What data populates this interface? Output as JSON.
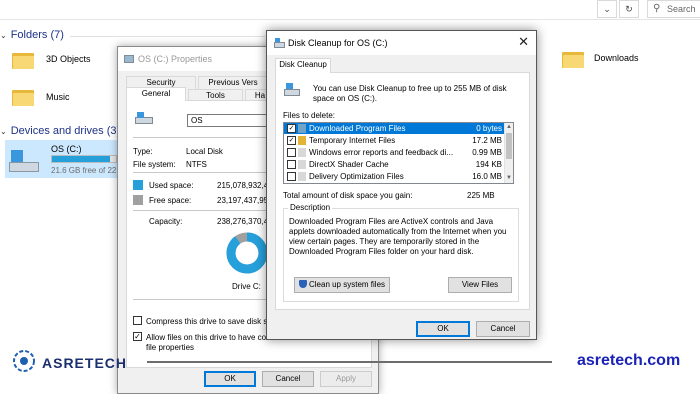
{
  "explorer": {
    "search_placeholder": "Search",
    "folders_header": "Folders (7)",
    "devices_header": "Devices and drives (3)",
    "folders": [
      {
        "name": "3D Objects"
      },
      {
        "name": "Music"
      },
      {
        "name": "Downloads"
      }
    ],
    "drive": {
      "name": "OS  (C:)",
      "free_text": "21.6 GB free of 221",
      "used_fraction": 0.9
    }
  },
  "properties": {
    "title": "OS  (C:) Properties",
    "tabs": [
      "Security",
      "Previous Vers",
      "General",
      "Tools",
      "Ha"
    ],
    "drive_label_value": "OS",
    "type_label": "Type:",
    "type_value": "Local Disk",
    "fs_label": "File system:",
    "fs_value": "NTFS",
    "used_label": "Used space:",
    "used_value": "215,078,932,48",
    "free_label": "Free space:",
    "free_value": "23,197,437,95",
    "capacity_label": "Capacity:",
    "capacity_value": "238,276,370,43",
    "drive_caption": "Drive C:",
    "compress_label": "Compress this drive to save disk spa",
    "index_label_1": "Allow files on this drive to have conte",
    "index_label_2": "file properties",
    "ok": "OK",
    "cancel": "Cancel",
    "apply": "Apply",
    "used_color": "#26a0da",
    "free_color": "#a0a0a0",
    "used_fraction": 0.9
  },
  "cleanup": {
    "title": "Disk Cleanup for OS  (C:)",
    "tab": "Disk Cleanup",
    "intro_line1": "You can use Disk Cleanup to free up to 255 MB of disk",
    "intro_line2": "space on OS  (C:).",
    "files_label": "Files to delete:",
    "files": [
      {
        "name": "Downloaded Program Files",
        "size": "0 bytes",
        "checked": true,
        "selected": true
      },
      {
        "name": "Temporary Internet Files",
        "size": "17.2 MB",
        "checked": true,
        "selected": false
      },
      {
        "name": "Windows error reports and feedback di...",
        "size": "0.99 MB",
        "checked": false,
        "selected": false
      },
      {
        "name": "DirectX Shader Cache",
        "size": "194 KB",
        "checked": false,
        "selected": false
      },
      {
        "name": "Delivery Optimization Files",
        "size": "16.0 MB",
        "checked": false,
        "selected": false
      }
    ],
    "total_label": "Total amount of disk space you gain:",
    "total_value": "225 MB",
    "description_legend": "Description",
    "description": "Downloaded Program Files are ActiveX controls and Java applets downloaded automatically from the Internet when you view certain pages. They are temporarily stored in the Downloaded Program Files folder on your hard disk.",
    "cleanup_system_btn": "Clean up system files",
    "view_files_btn": "View Files",
    "ok": "OK",
    "cancel": "Cancel"
  },
  "watermark": {
    "logo_text": "ASRETECH",
    "site_text": "asretech.com"
  }
}
